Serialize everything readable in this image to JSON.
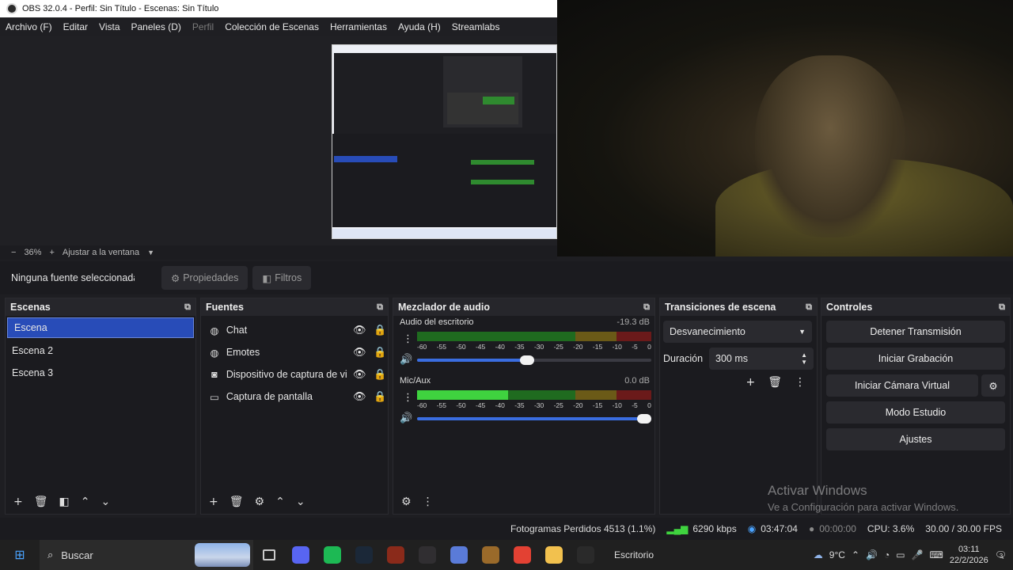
{
  "window": {
    "title": "OBS 32.0.4 - Perfil: Sin Título - Escenas: Sin Título"
  },
  "menu": [
    {
      "label": "Archivo (F)",
      "disabled": false
    },
    {
      "label": "Editar",
      "disabled": false
    },
    {
      "label": "Vista",
      "disabled": false
    },
    {
      "label": "Paneles (D)",
      "disabled": false
    },
    {
      "label": "Perfil",
      "disabled": true
    },
    {
      "label": "Colección de Escenas",
      "disabled": false
    },
    {
      "label": "Herramientas",
      "disabled": false
    },
    {
      "label": "Ayuda (H)",
      "disabled": false
    },
    {
      "label": "Streamlabs",
      "disabled": false
    }
  ],
  "preview": {
    "zoom_minus": "−",
    "zoom": "36%",
    "zoom_plus": "+",
    "fit_label": "Ajustar a la ventana"
  },
  "source_toolbar": {
    "no_source": "Ninguna fuente seleccionada",
    "properties": "Propiedades",
    "filters": "Filtros"
  },
  "scenes": {
    "title": "Escenas",
    "items": [
      {
        "label": "Escena",
        "selected": true
      },
      {
        "label": "Escena 2",
        "selected": false
      },
      {
        "label": "Escena 3",
        "selected": false
      }
    ]
  },
  "sources": {
    "title": "Fuentes",
    "items": [
      {
        "label": "Chat",
        "icon": "globe-icon",
        "glyph": "◍"
      },
      {
        "label": "Emotes",
        "icon": "globe-icon",
        "glyph": "◍"
      },
      {
        "label": "Dispositivo de captura de video",
        "icon": "camera-icon",
        "glyph": "◙"
      },
      {
        "label": "Captura de pantalla",
        "icon": "monitor-icon",
        "glyph": "▭"
      }
    ]
  },
  "mixer": {
    "title": "Mezclador de audio",
    "ticks": [
      "-60",
      "-55",
      "-50",
      "-45",
      "-40",
      "-35",
      "-30",
      "-25",
      "-20",
      "-15",
      "-10",
      "-5",
      "0"
    ],
    "channels": [
      {
        "name": "Audio del escritorio",
        "db": "-19.3 dB",
        "level": 0,
        "volume": 0.5
      },
      {
        "name": "Mic/Aux",
        "db": "0.0 dB",
        "level": 0.39,
        "volume": 1.0
      }
    ]
  },
  "transitions": {
    "title": "Transiciones de escena",
    "selected": "Desvanecimiento",
    "duration_label": "Duración",
    "duration_value": "300 ms"
  },
  "controls": {
    "title": "Controles",
    "buttons": [
      "Detener Transmisión",
      "Iniciar Grabación",
      "Iniciar Cámara Virtual",
      "Modo Estudio",
      "Ajustes"
    ]
  },
  "status": {
    "dropped": "Fotogramas Perdidos 4513 (1.1%)",
    "bitrate": "6290 kbps",
    "stream_time": "03:47:04",
    "rec_time": "00:00:00",
    "cpu": "CPU: 3.6%",
    "fps": "30.00 / 30.00 FPS"
  },
  "watermark": {
    "title": "Activar Windows",
    "subtitle": "Ve a Configuración para activar Windows."
  },
  "taskbar": {
    "search": "Buscar",
    "desktop": "Escritorio",
    "temp": "9°C",
    "time": "03:11",
    "date": "22/2/2026",
    "notifications": "3",
    "apps": [
      {
        "name": "discord-icon",
        "color": "#5865f2"
      },
      {
        "name": "spotify-icon",
        "color": "#1db954"
      },
      {
        "name": "steam-icon",
        "color": "#1b2838"
      },
      {
        "name": "game-icon",
        "color": "#8a2a1a"
      },
      {
        "name": "obs-icon",
        "color": "#302e31"
      },
      {
        "name": "app-icon",
        "color": "#5a7bd8"
      },
      {
        "name": "game-2-icon",
        "color": "#9a6a2a"
      },
      {
        "name": "chrome-icon",
        "color": "#e34133"
      },
      {
        "name": "folder-icon",
        "color": "#f2c14e"
      },
      {
        "name": "epic-games-icon",
        "color": "#2a2a2a"
      }
    ]
  }
}
